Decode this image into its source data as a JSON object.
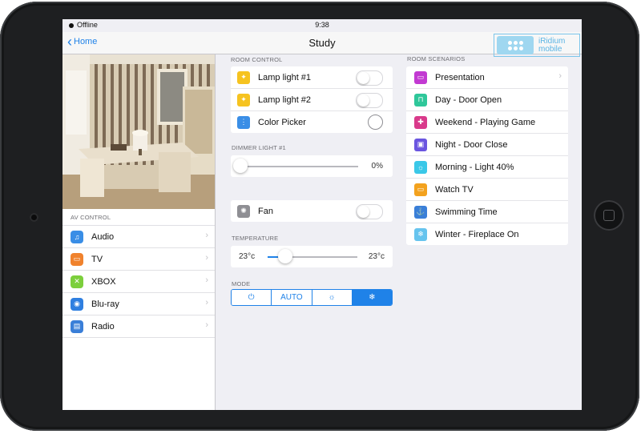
{
  "status": {
    "carrier": "Offline",
    "time": "9:38"
  },
  "nav": {
    "back_label": "Home",
    "title": "Study"
  },
  "logo": {
    "line1": "iRidium",
    "line2": "mobile"
  },
  "av": {
    "header": "AV CONTROL",
    "items": [
      {
        "label": "Audio",
        "icon": "music-note-icon",
        "color": "#3a8ee6"
      },
      {
        "label": "TV",
        "icon": "tv-icon",
        "color": "#f0822d"
      },
      {
        "label": "XBOX",
        "icon": "xbox-icon",
        "color": "#7ccf3c"
      },
      {
        "label": "Blu-ray",
        "icon": "bluray-disc-icon",
        "color": "#2f7fe0"
      },
      {
        "label": "Radio",
        "icon": "radio-icon",
        "color": "#3a7fd8"
      }
    ]
  },
  "room": {
    "header": "ROOM CONTROL",
    "items": [
      {
        "label": "Lamp light #1",
        "icon": "lightbulb-icon",
        "color": "#f6c320",
        "control": "toggle",
        "state": "off"
      },
      {
        "label": "Lamp light #2",
        "icon": "lightbulb-icon",
        "color": "#f6c320",
        "control": "toggle",
        "state": "off"
      },
      {
        "label": "Color Picker",
        "icon": "sliders-icon",
        "color": "#3a8ee6",
        "control": "circle"
      }
    ]
  },
  "dimmer": {
    "header": "DIMMER LIGHT #1",
    "value_label": "0%",
    "level": 0
  },
  "fan": {
    "label": "Fan",
    "icon": "fan-icon",
    "color": "#8e8e93",
    "state": "off"
  },
  "temperature": {
    "header": "TEMPERATURE",
    "min_label": "23°c",
    "max_label": "23°c",
    "level": 0.2
  },
  "mode": {
    "header": "MODE",
    "options": [
      {
        "label": "⏻",
        "name": "power"
      },
      {
        "label": "AUTO",
        "name": "auto"
      },
      {
        "label": "☼",
        "name": "heat"
      },
      {
        "label": "❄",
        "name": "cool"
      }
    ],
    "selected": "cool"
  },
  "scenarios": {
    "header": "ROOM SCENARIOS",
    "items": [
      {
        "label": "Presentation",
        "icon": "presentation-icon",
        "color": "#c23ad2"
      },
      {
        "label": "Day - Door Open",
        "icon": "lock-open-icon",
        "color": "#2fc79a"
      },
      {
        "label": "Weekend - Playing Game",
        "icon": "gamepad-icon",
        "color": "#d93a8b"
      },
      {
        "label": "Night - Door Close",
        "icon": "lock-icon",
        "color": "#6a55e0"
      },
      {
        "label": "Morning - Light 40%",
        "icon": "sun-icon",
        "color": "#3ac8e8"
      },
      {
        "label": "Watch TV",
        "icon": "tv-icon",
        "color": "#f3a21e"
      },
      {
        "label": "Swimming Time",
        "icon": "anchor-icon",
        "color": "#3a7fd8"
      },
      {
        "label": "Winter - Fireplace On",
        "icon": "snowflake-icon",
        "color": "#66c4ee"
      }
    ]
  }
}
